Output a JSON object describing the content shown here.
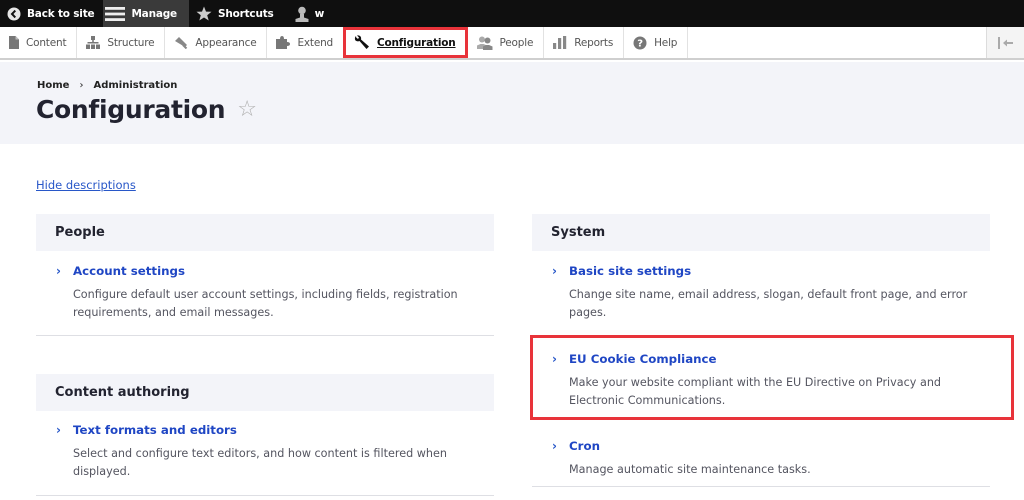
{
  "toolbar": {
    "items": [
      {
        "label": "Back to site",
        "icon": "back-circle-icon"
      },
      {
        "label": "Manage",
        "icon": "hamburger-icon",
        "active": true
      },
      {
        "label": "Shortcuts",
        "icon": "star-icon"
      },
      {
        "label": "w",
        "icon": "user-icon"
      }
    ]
  },
  "tray": {
    "tabs": [
      {
        "label": "Content",
        "icon": "file-icon"
      },
      {
        "label": "Structure",
        "icon": "sitemap-icon"
      },
      {
        "label": "Appearance",
        "icon": "paintbrush-icon"
      },
      {
        "label": "Extend",
        "icon": "puzzle-icon"
      },
      {
        "label": "Configuration",
        "icon": "wrench-icon",
        "active": true
      },
      {
        "label": "People",
        "icon": "people-icon"
      },
      {
        "label": "Reports",
        "icon": "bar-chart-icon"
      },
      {
        "label": "Help",
        "icon": "help-icon"
      }
    ],
    "orientation_toggle": "orientation-toggle-icon"
  },
  "breadcrumb": {
    "items": [
      "Home",
      "Administration"
    ],
    "separator": "›"
  },
  "page": {
    "title": "Configuration",
    "shortcut_star": "☆"
  },
  "hide_descriptions": "Hide descriptions",
  "highlight_color": "#e8333a",
  "link_color": "#1f46c4",
  "panels": {
    "people": {
      "title": "People",
      "items": [
        {
          "label": "Account settings",
          "description": "Configure default user account settings, including fields, registration requirements, and email messages."
        }
      ]
    },
    "content_authoring": {
      "title": "Content authoring",
      "items": [
        {
          "label": "Text formats and editors",
          "description": "Select and configure text editors, and how content is filtered when displayed."
        }
      ]
    },
    "system": {
      "title": "System",
      "items": [
        {
          "label": "Basic site settings",
          "description": "Change site name, email address, slogan, default front page, and error pages."
        },
        {
          "label": "EU Cookie Compliance",
          "description": "Make your website compliant with the EU Directive on Privacy and Electronic Communications."
        },
        {
          "label": "Cron",
          "description": "Manage automatic site maintenance tasks."
        }
      ]
    }
  },
  "chevron": "›"
}
